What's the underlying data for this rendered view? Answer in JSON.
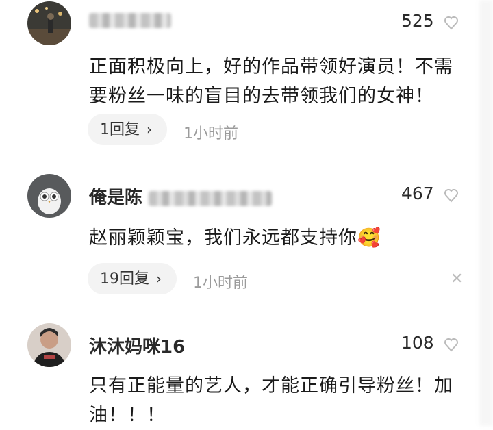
{
  "comments": [
    {
      "username": "",
      "likes": "525",
      "text": "正面积极向上，好的作品带领好演员！不需要粉丝一味的盲目的去带领我们的女神！",
      "reply_label": "1回复",
      "time": "1小时前"
    },
    {
      "username": "俺是陈",
      "likes": "467",
      "text": "赵丽颖颖宝，我们永远都支持你",
      "emoji": "🥰",
      "reply_label": "19回复",
      "time": "1小时前"
    },
    {
      "username": "沐沐妈咪16",
      "likes": "108",
      "text": "只有正能量的艺人，才能正确引导粉丝！加油！！！"
    }
  ],
  "icons": {
    "like": "heart-outline-icon",
    "reply_chevron": "chevron-right-icon",
    "close": "close-icon"
  },
  "colors": {
    "pill_background": "#f3f3f3",
    "time_text": "#9b9b9b"
  }
}
